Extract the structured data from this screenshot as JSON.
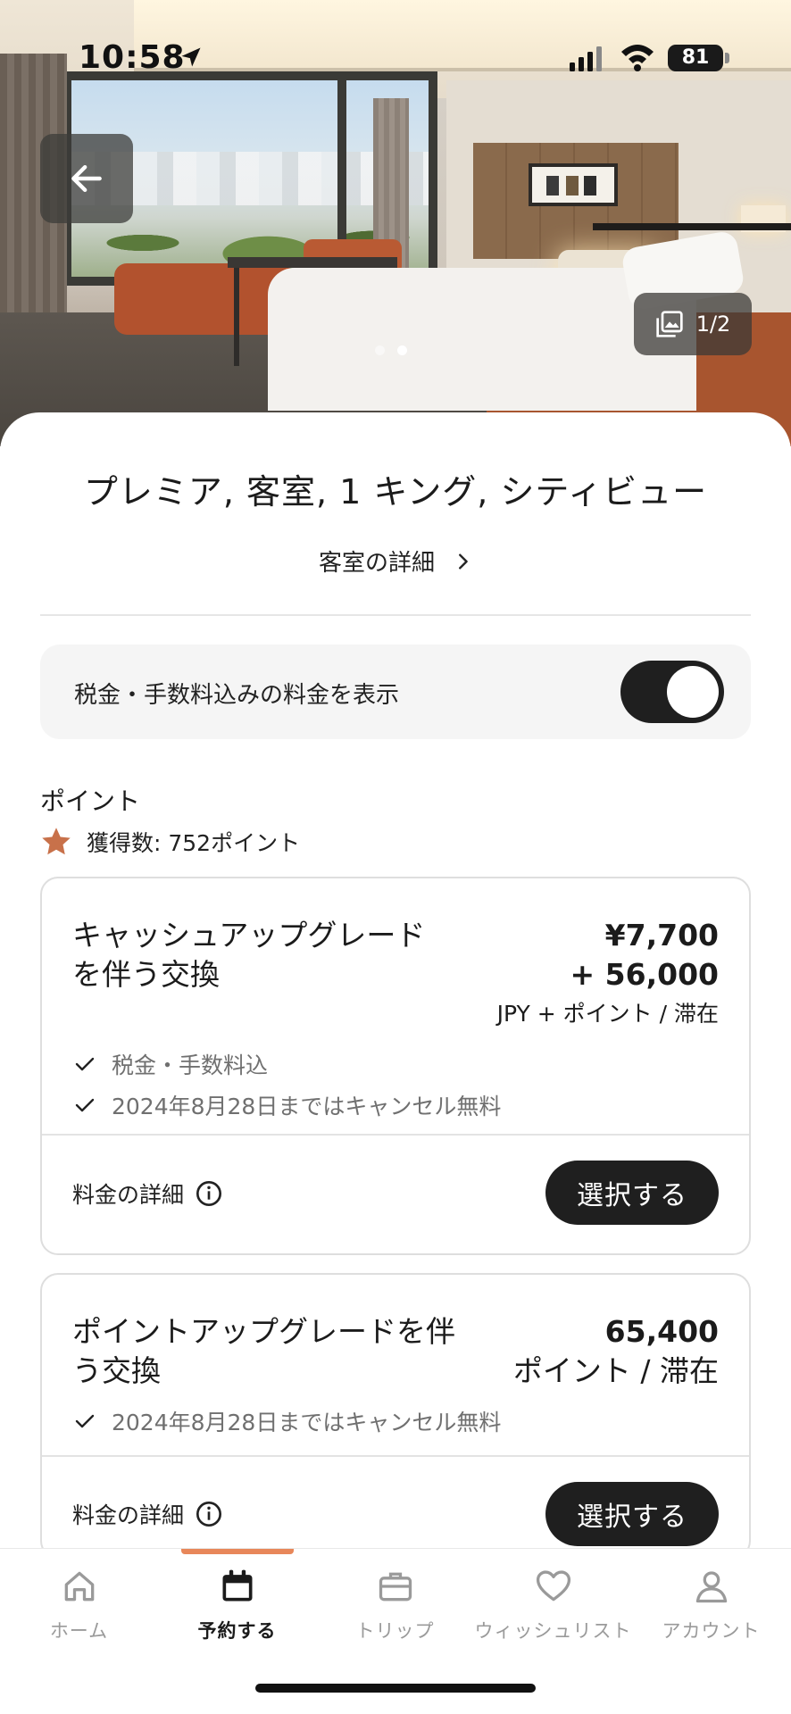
{
  "status_bar": {
    "time": "10:58",
    "battery": "81"
  },
  "hero": {
    "gallery_count": "1/2",
    "page_total": 2,
    "page_active": 2
  },
  "room": {
    "title": "プレミア, 客室, 1 キング, シティビュー",
    "details_link": "客室の詳細"
  },
  "tax_toggle": {
    "label": "税金・手数料込みの料金を表示",
    "enabled": true
  },
  "points": {
    "heading": "ポイント",
    "earn_text": "獲得数: 752ポイント"
  },
  "rates": [
    {
      "name": "キャッシュアップグレードを伴う交換",
      "price_line1": "¥7,700",
      "price_line2": "+ 56,000",
      "unit": "JPY + ポイント / 滞在",
      "perks": [
        "税金・手数料込",
        "2024年8月28日まではキャンセル無料"
      ],
      "fare_details": "料金の詳細",
      "select_label": "選択する"
    },
    {
      "name": "ポイントアップグレードを伴う交換",
      "price_line1": "65,400",
      "unit": "ポイント / 滞在",
      "perks": [
        "2024年8月28日まではキャンセル無料"
      ],
      "fare_details": "料金の詳細",
      "select_label": "選択する"
    }
  ],
  "tab_bar": {
    "active": "book",
    "accent_color": "#e8875a",
    "tabs": [
      {
        "id": "home",
        "label": "ホーム",
        "icon": "home-icon"
      },
      {
        "id": "book",
        "label": "予約する",
        "icon": "calendar-icon"
      },
      {
        "id": "trips",
        "label": "トリップ",
        "icon": "briefcase-icon"
      },
      {
        "id": "wishlist",
        "label": "ウィッシュリスト",
        "icon": "heart-icon"
      },
      {
        "id": "account",
        "label": "アカウント",
        "icon": "user-icon"
      }
    ]
  }
}
